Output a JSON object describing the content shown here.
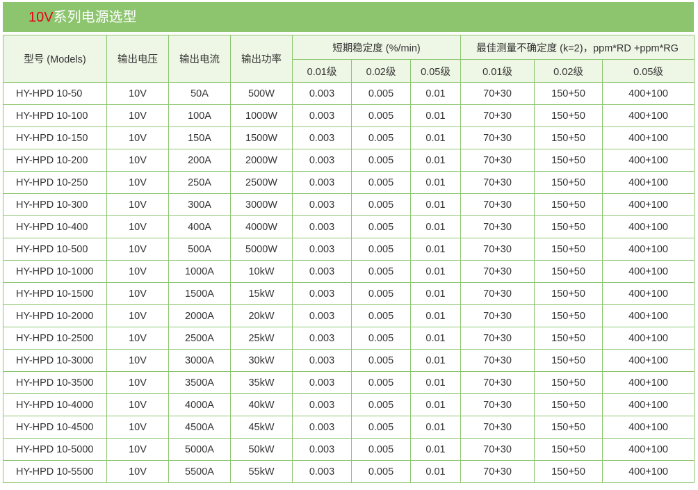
{
  "banner": {
    "accent": "10V",
    "title": "系列电源选型",
    "bg_color": "#8cc56e",
    "accent_color": "#e6001a"
  },
  "table": {
    "headers": {
      "model": "型号 (Models)",
      "voltage": "输出电压",
      "current": "输出电流",
      "power": "输出功率",
      "stability": "短期稳定度 (%/min)",
      "uncertainty": "最佳测量不确定度 (k=2)，ppm*RD +ppm*RG",
      "stability_sub": [
        "0.01级",
        "0.02级",
        "0.05级"
      ],
      "uncertainty_sub": [
        "0.01级",
        "0.02级",
        "0.05级"
      ]
    },
    "rows": [
      [
        "HY-HPD 10-50",
        "10V",
        "50A",
        "500W",
        "0.003",
        "0.005",
        "0.01",
        "70+30",
        "150+50",
        "400+100"
      ],
      [
        "HY-HPD 10-100",
        "10V",
        "100A",
        "1000W",
        "0.003",
        "0.005",
        "0.01",
        "70+30",
        "150+50",
        "400+100"
      ],
      [
        "HY-HPD 10-150",
        "10V",
        "150A",
        "1500W",
        "0.003",
        "0.005",
        "0.01",
        "70+30",
        "150+50",
        "400+100"
      ],
      [
        "HY-HPD 10-200",
        "10V",
        "200A",
        "2000W",
        "0.003",
        "0.005",
        "0.01",
        "70+30",
        "150+50",
        "400+100"
      ],
      [
        "HY-HPD 10-250",
        "10V",
        "250A",
        "2500W",
        "0.003",
        "0.005",
        "0.01",
        "70+30",
        "150+50",
        "400+100"
      ],
      [
        "HY-HPD 10-300",
        "10V",
        "300A",
        "3000W",
        "0.003",
        "0.005",
        "0.01",
        "70+30",
        "150+50",
        "400+100"
      ],
      [
        "HY-HPD 10-400",
        "10V",
        "400A",
        "4000W",
        "0.003",
        "0.005",
        "0.01",
        "70+30",
        "150+50",
        "400+100"
      ],
      [
        "HY-HPD 10-500",
        "10V",
        "500A",
        "5000W",
        "0.003",
        "0.005",
        "0.01",
        "70+30",
        "150+50",
        "400+100"
      ],
      [
        "HY-HPD 10-1000",
        "10V",
        "1000A",
        "10kW",
        "0.003",
        "0.005",
        "0.01",
        "70+30",
        "150+50",
        "400+100"
      ],
      [
        "HY-HPD 10-1500",
        "10V",
        "1500A",
        "15kW",
        "0.003",
        "0.005",
        "0.01",
        "70+30",
        "150+50",
        "400+100"
      ],
      [
        "HY-HPD 10-2000",
        "10V",
        "2000A",
        "20kW",
        "0.003",
        "0.005",
        "0.01",
        "70+30",
        "150+50",
        "400+100"
      ],
      [
        "HY-HPD 10-2500",
        "10V",
        "2500A",
        "25kW",
        "0.003",
        "0.005",
        "0.01",
        "70+30",
        "150+50",
        "400+100"
      ],
      [
        "HY-HPD 10-3000",
        "10V",
        "3000A",
        "30kW",
        "0.003",
        "0.005",
        "0.01",
        "70+30",
        "150+50",
        "400+100"
      ],
      [
        "HY-HPD 10-3500",
        "10V",
        "3500A",
        "35kW",
        "0.003",
        "0.005",
        "0.01",
        "70+30",
        "150+50",
        "400+100"
      ],
      [
        "HY-HPD 10-4000",
        "10V",
        "4000A",
        "40kW",
        "0.003",
        "0.005",
        "0.01",
        "70+30",
        "150+50",
        "400+100"
      ],
      [
        "HY-HPD 10-4500",
        "10V",
        "4500A",
        "45kW",
        "0.003",
        "0.005",
        "0.01",
        "70+30",
        "150+50",
        "400+100"
      ],
      [
        "HY-HPD 10-5000",
        "10V",
        "5000A",
        "50kW",
        "0.003",
        "0.005",
        "0.01",
        "70+30",
        "150+50",
        "400+100"
      ],
      [
        "HY-HPD 10-5500",
        "10V",
        "5500A",
        "55kW",
        "0.003",
        "0.005",
        "0.01",
        "70+30",
        "150+50",
        "400+100"
      ]
    ]
  }
}
